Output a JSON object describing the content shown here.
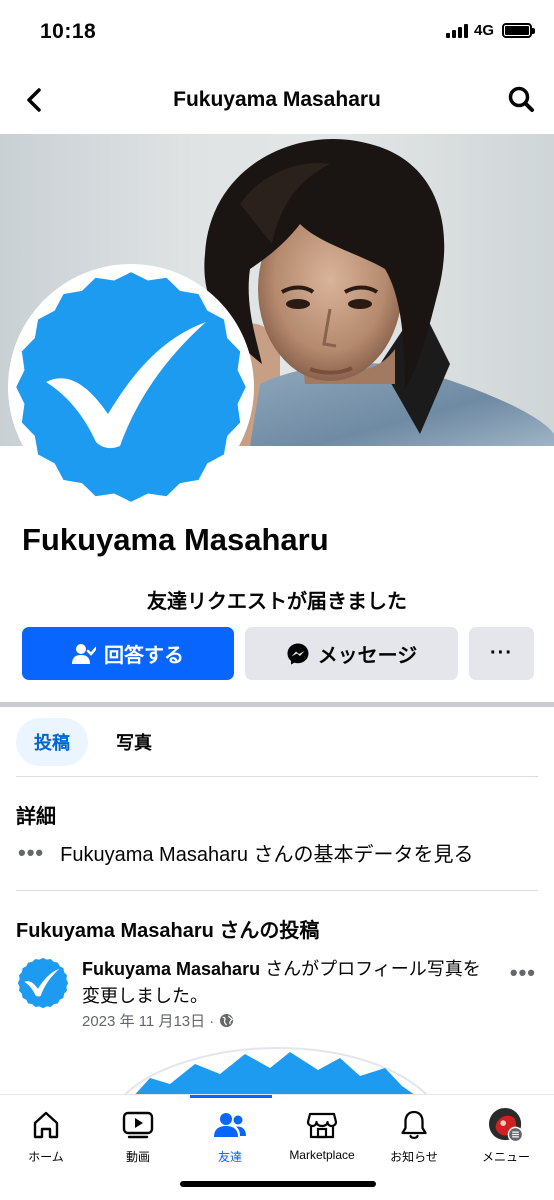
{
  "status_bar": {
    "time": "10:18",
    "network": "4G"
  },
  "header": {
    "title": "Fukuyama Masaharu"
  },
  "profile": {
    "name": "Fukuyama Masaharu",
    "friend_request_notice": "友達リクエストが届きました"
  },
  "actions": {
    "respond_label": "回答する",
    "message_label": "メッセージ",
    "more_label": "···"
  },
  "tabs": [
    {
      "label": "投稿",
      "active": true
    },
    {
      "label": "写真",
      "active": false
    }
  ],
  "details": {
    "title": "詳細",
    "more": "•••",
    "basic_info_text": "Fukuyama Masaharu さんの基本データを見る"
  },
  "posts": {
    "section_title": "Fukuyama Masaharu さんの投稿",
    "items": [
      {
        "author": "Fukuyama Masaharu",
        "action": " さんがプロフィール写真を変更しました。",
        "date": "2023 年 11 月13日 ·",
        "more": "•••"
      }
    ]
  },
  "bottom_nav": [
    {
      "label": "ホーム",
      "icon": "home-icon",
      "active": false
    },
    {
      "label": "動画",
      "icon": "video-icon",
      "active": false
    },
    {
      "label": "友達",
      "icon": "friends-icon",
      "active": true
    },
    {
      "label": "Marketplace",
      "icon": "marketplace-icon",
      "active": false
    },
    {
      "label": "お知らせ",
      "icon": "bell-icon",
      "active": false
    },
    {
      "label": "メニュー",
      "icon": "menu-avatar-icon",
      "active": false
    }
  ],
  "colors": {
    "primary": "#0866ff",
    "verified_blue": "#1d9bf0",
    "secondary_button": "#e4e6eb",
    "active_tab_bg": "#ebf5ff"
  }
}
